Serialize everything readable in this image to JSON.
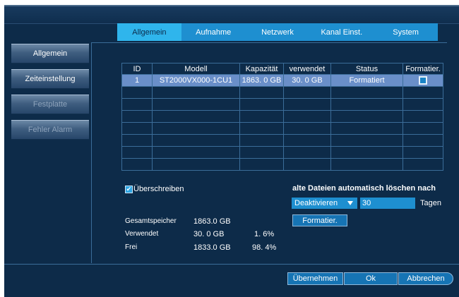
{
  "tabs": [
    {
      "label": "Allgemein",
      "active": true
    },
    {
      "label": "Aufnahme",
      "active": false
    },
    {
      "label": "Netzwerk",
      "active": false
    },
    {
      "label": "Kanal Einst.",
      "active": false
    },
    {
      "label": "System",
      "active": false
    }
  ],
  "sidebar": {
    "items": [
      {
        "label": "Allgemein"
      },
      {
        "label": "Zeiteinstellung"
      },
      {
        "label": "Festplatte"
      },
      {
        "label": "Fehler Alarm"
      }
    ]
  },
  "disk_table": {
    "headers": [
      "ID",
      "Modell",
      "Kapazität",
      "verwendet",
      "Status",
      "Formatier."
    ],
    "rows": [
      {
        "id": "1",
        "model": "ST2000VX000-1CU1",
        "capacity": "1863. 0 GB",
        "used": "30. 0 GB",
        "status": "Formatiert",
        "format_checked": true
      }
    ],
    "empty_rows": 7
  },
  "overwrite": {
    "label": "Überschreiben",
    "checked": true
  },
  "storage": {
    "total_label": "Gesamtspeicher",
    "total_value": "1863.0  GB",
    "used_label": "Verwendet",
    "used_value": "30. 0  GB",
    "used_percent": "1. 6%",
    "free_label": "Frei",
    "free_value": "1833.0  GB",
    "free_percent": "98. 4%"
  },
  "auto_delete": {
    "title": "alte Dateien automatisch löschen nach",
    "selected": "Deaktivieren",
    "days_value": "30",
    "days_unit": "Tagen"
  },
  "buttons": {
    "format": "Formatier.",
    "apply": "Übernehmen",
    "ok": "Ok",
    "cancel": "Abbrechen"
  },
  "colors": {
    "background": "#0d2b49",
    "tab_bar": "#1e8fd0",
    "tab_active": "#2fb5ec",
    "selected_row": "#6a8fc9",
    "button": "#1674b4"
  }
}
